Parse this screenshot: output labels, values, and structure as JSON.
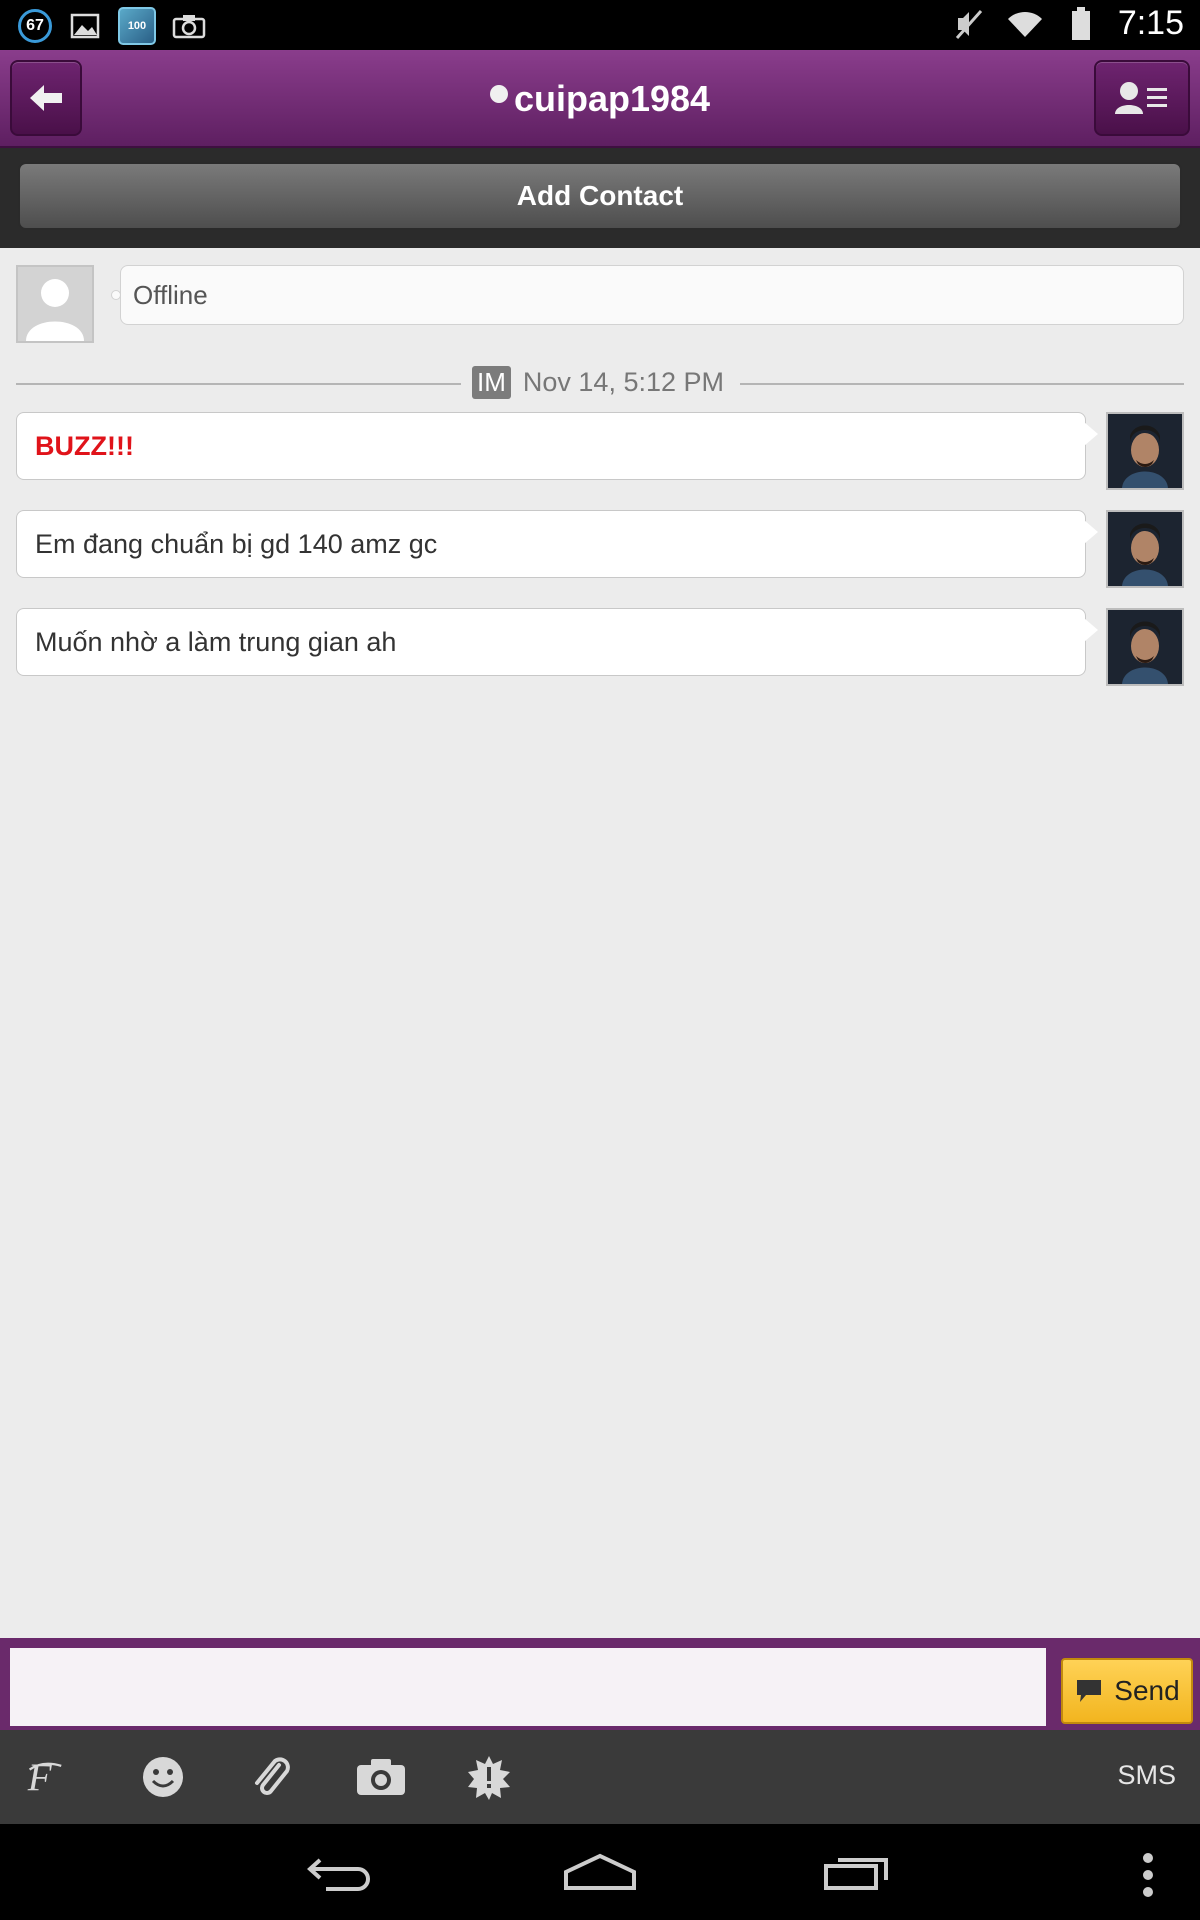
{
  "status_bar": {
    "notification_badge": "67",
    "game_icon_text": "100",
    "time": "7:15"
  },
  "header": {
    "title": "cuipap1984",
    "back_icon": "back-arrow-icon",
    "profile_icon": "profile-menu-icon"
  },
  "add_contact_label": "Add Contact",
  "contact_status": "Offline",
  "conversation": {
    "im_badge": "IM",
    "timestamp": "Nov 14, 5:12 PM",
    "messages": [
      {
        "text": "BUZZ!!!",
        "type": "buzz"
      },
      {
        "text": "Em đang chuẩn bị gd 140 amz gc",
        "type": "normal"
      },
      {
        "text": "Muốn nhờ a làm trung gian ah",
        "type": "normal"
      }
    ]
  },
  "composer": {
    "input_value": "",
    "input_placeholder": "",
    "send_label": "Send"
  },
  "toolbar": {
    "icons": [
      "font-icon",
      "emoji-icon",
      "attachment-icon",
      "camera-icon",
      "buzz-icon"
    ],
    "sms_label": "SMS"
  },
  "colors": {
    "header_purple": "#7a2f7c",
    "buzz_red": "#e0131a",
    "send_yellow": "#f7c23a"
  }
}
